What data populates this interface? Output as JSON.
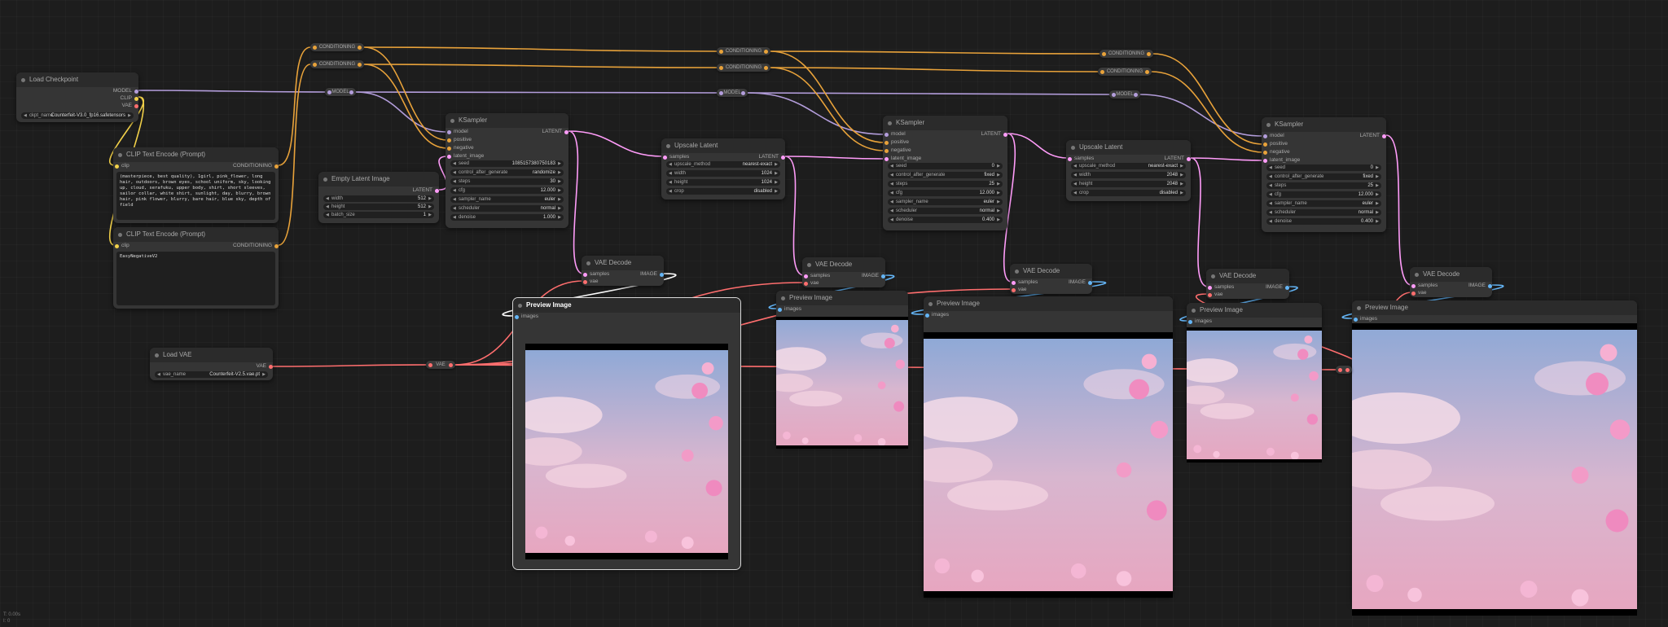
{
  "colors": {
    "conditioning": "#e8a23a",
    "model": "#b39ddb",
    "clip": "#f2d14a",
    "vae": "#ff6e6e",
    "latent": "#ff9cf9",
    "image": "#64b5f6"
  },
  "load_checkpoint": {
    "title": "Load Checkpoint",
    "out_model": "MODEL",
    "out_clip": "CLIP",
    "out_vae": "VAE",
    "ckpt_label": "ckpt_name",
    "ckpt_value": "Counterfeit-V3.0_fp16.safetensors"
  },
  "clip_pos": {
    "title": "CLIP Text Encode (Prompt)",
    "in_clip": "clip",
    "out": "CONDITIONING",
    "text": "(masterpiece, best quality), 1girl, pink_flower, long hair, outdoors, brown eyes, school uniform, sky, looking up, cloud, serafuku, upper body, shirt, short sleeves, sailor collar, white shirt, sunlight, day, blurry, brown hair, pink flower, blurry, bare hair, blue sky, depth of field"
  },
  "clip_neg": {
    "title": "CLIP Text Encode (Prompt)",
    "in_clip": "clip",
    "out": "CONDITIONING",
    "text": "EasyNegativeV2"
  },
  "empty_latent": {
    "title": "Empty Latent Image",
    "out": "LATENT",
    "widgets": [
      {
        "label": "width",
        "value": "512"
      },
      {
        "label": "height",
        "value": "512"
      },
      {
        "label": "batch_size",
        "value": "1"
      }
    ]
  },
  "load_vae": {
    "title": "Load VAE",
    "out": "VAE",
    "vae_label": "vae_name",
    "vae_value": "Counterfeit-V2.5.vae.pt"
  },
  "ksampler_1": {
    "title": "KSampler",
    "inputs": [
      "model",
      "positive",
      "negative",
      "latent_image"
    ],
    "out": "LATENT",
    "widgets": [
      {
        "label": "seed",
        "value": "1085157380750183"
      },
      {
        "label": "control_after_generate",
        "value": "randomize"
      },
      {
        "label": "steps",
        "value": "30"
      },
      {
        "label": "cfg",
        "value": "12.000"
      },
      {
        "label": "sampler_name",
        "value": "euler"
      },
      {
        "label": "scheduler",
        "value": "normal"
      },
      {
        "label": "denoise",
        "value": "1.000"
      }
    ]
  },
  "ksampler_2": {
    "title": "KSampler",
    "inputs": [
      "model",
      "positive",
      "negative",
      "latent_image"
    ],
    "out": "LATENT",
    "widgets": [
      {
        "label": "seed",
        "value": "0"
      },
      {
        "label": "control_after_generate",
        "value": "fixed"
      },
      {
        "label": "steps",
        "value": "25"
      },
      {
        "label": "cfg",
        "value": "12.000"
      },
      {
        "label": "sampler_name",
        "value": "euler"
      },
      {
        "label": "scheduler",
        "value": "normal"
      },
      {
        "label": "denoise",
        "value": "0.400"
      }
    ]
  },
  "ksampler_3": {
    "title": "KSampler",
    "inputs": [
      "model",
      "positive",
      "negative",
      "latent_image"
    ],
    "out": "LATENT",
    "widgets": [
      {
        "label": "seed",
        "value": "0"
      },
      {
        "label": "control_after_generate",
        "value": "fixed"
      },
      {
        "label": "steps",
        "value": "25"
      },
      {
        "label": "cfg",
        "value": "12.000"
      },
      {
        "label": "sampler_name",
        "value": "euler"
      },
      {
        "label": "scheduler",
        "value": "normal"
      },
      {
        "label": "denoise",
        "value": "0.400"
      }
    ]
  },
  "upscale_1": {
    "title": "Upscale Latent",
    "in": "samples",
    "out": "LATENT",
    "widgets": [
      {
        "label": "upscale_method",
        "value": "nearest-exact"
      },
      {
        "label": "width",
        "value": "1024"
      },
      {
        "label": "height",
        "value": "1024"
      },
      {
        "label": "crop",
        "value": "disabled"
      }
    ]
  },
  "upscale_2": {
    "title": "Upscale Latent",
    "in": "samples",
    "out": "LATENT",
    "widgets": [
      {
        "label": "upscale_method",
        "value": "nearest-exact"
      },
      {
        "label": "width",
        "value": "2048"
      },
      {
        "label": "height",
        "value": "2048"
      },
      {
        "label": "crop",
        "value": "disabled"
      }
    ]
  },
  "vae_decode": {
    "title": "VAE Decode",
    "in_samples": "samples",
    "in_vae": "vae",
    "out": "IMAGE"
  },
  "preview": {
    "title": "Preview Image",
    "in": "images"
  },
  "reroutes": {
    "conditioning": "CONDITIONING",
    "model": "MODEL",
    "vae": "VAE"
  },
  "status": {
    "line1": "T: 0.00s",
    "line2": "I: 0"
  }
}
